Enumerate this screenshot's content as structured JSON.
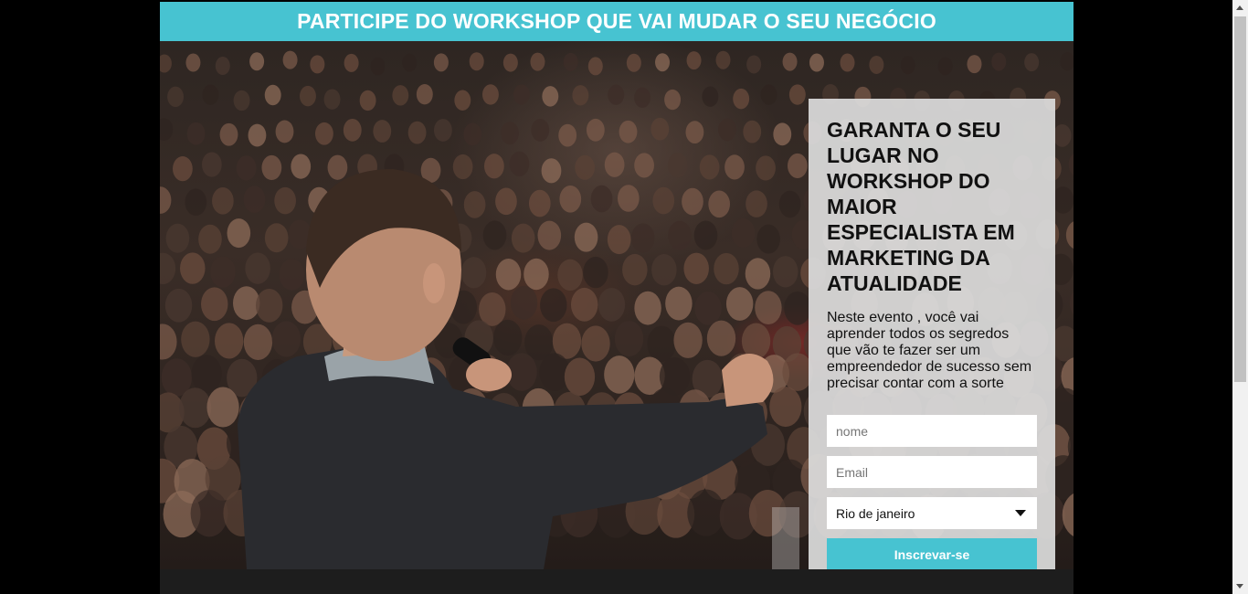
{
  "banner": {
    "title": "PARTICIPE DO WORKSHOP QUE VAI MUDAR O SEU NEGÓCIO"
  },
  "form": {
    "heading": "GARANTA O SEU LUGAR NO WORKSHOP DO MAIOR ESPECIALISTA EM MARKETING DA ATUALIDADE",
    "description": "Neste evento , você vai aprender todos os segredos que vão te fazer ser um empreendedor de sucesso sem precisar contar com a sorte",
    "name_placeholder": "nome",
    "email_placeholder": "Email",
    "city_selected": "Rio de janeiro",
    "submit_label": "Inscrevar-se"
  },
  "colors": {
    "accent": "#47c3d1",
    "card_bg": "#dcdcdc"
  },
  "icons": {
    "select_arrow": "caret-down-icon"
  }
}
